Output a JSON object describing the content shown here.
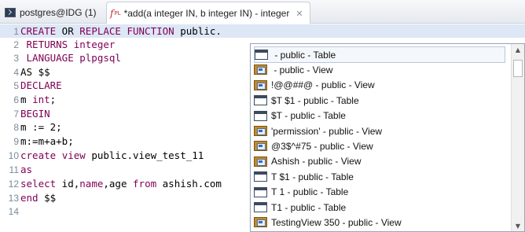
{
  "tabs": [
    {
      "label": "postgres@IDG (1)",
      "icon": "terminal-icon"
    },
    {
      "label": "*add(a integer IN, b integer IN) - integer",
      "icon": "function-icon",
      "icon_text": "f",
      "icon_sub": "PL"
    }
  ],
  "close_glyph": "✕",
  "editor": {
    "lines": [
      {
        "num": "1",
        "parts": [
          {
            "t": "CREATE",
            "k": true
          },
          {
            "t": " OR ",
            "k": false
          },
          {
            "t": "REPLACE",
            "k": true
          },
          {
            "t": " ",
            "k": false
          },
          {
            "t": "FUNCTION",
            "k": true
          },
          {
            "t": " public.",
            "k": false
          }
        ]
      },
      {
        "num": "2",
        "parts": [
          {
            "t": " RETURNS integer",
            "k": true
          }
        ]
      },
      {
        "num": "3",
        "parts": [
          {
            "t": " LANGUAGE plpgsql",
            "k": true
          }
        ]
      },
      {
        "num": "4",
        "parts": [
          {
            "t": "AS $$",
            "k": false
          }
        ]
      },
      {
        "num": "5",
        "parts": [
          {
            "t": "DECLARE",
            "k": true
          }
        ]
      },
      {
        "num": "6",
        "parts": [
          {
            "t": "m ",
            "k": false
          },
          {
            "t": "int",
            "k": true
          },
          {
            "t": ";",
            "k": false
          }
        ]
      },
      {
        "num": "7",
        "parts": [
          {
            "t": "BEGIN",
            "k": true
          }
        ]
      },
      {
        "num": "8",
        "parts": [
          {
            "t": "m := 2;",
            "k": false
          }
        ]
      },
      {
        "num": "9",
        "parts": [
          {
            "t": "m:=m+a+b;",
            "k": false
          }
        ]
      },
      {
        "num": "10",
        "parts": [
          {
            "t": "create",
            "k": true
          },
          {
            "t": " ",
            "k": false
          },
          {
            "t": "view",
            "k": true
          },
          {
            "t": " public.view_test_11",
            "k": false
          }
        ]
      },
      {
        "num": "11",
        "parts": [
          {
            "t": "as",
            "k": true
          }
        ]
      },
      {
        "num": "12",
        "parts": [
          {
            "t": "select",
            "k": true
          },
          {
            "t": " id,",
            "k": false
          },
          {
            "t": "name",
            "k": true
          },
          {
            "t": ",age ",
            "k": false
          },
          {
            "t": "from",
            "k": true
          },
          {
            "t": " ashish.com",
            "k": false
          }
        ]
      },
      {
        "num": "13",
        "parts": [
          {
            "t": "end",
            "k": true
          },
          {
            "t": " $$",
            "k": false
          }
        ]
      },
      {
        "num": "14",
        "parts": []
      }
    ]
  },
  "autocomplete": {
    "items": [
      {
        "label": " - public - Table",
        "type": "table"
      },
      {
        "label": " - public - View",
        "type": "view"
      },
      {
        "label": "!@@##@ - public - View",
        "type": "view"
      },
      {
        "label": "$T $1 - public - Table",
        "type": "table"
      },
      {
        "label": "$T - public - Table",
        "type": "table"
      },
      {
        "label": "'permission' - public - View",
        "type": "view"
      },
      {
        "label": "@3$^#75 - public - View",
        "type": "view"
      },
      {
        "label": "Ashish - public - View",
        "type": "view"
      },
      {
        "label": "T $1 - public - Table",
        "type": "table"
      },
      {
        "label": "T 1 - public - Table",
        "type": "table"
      },
      {
        "label": "T1 - public - Table",
        "type": "table"
      },
      {
        "label": "TestingView 350 - public - View",
        "type": "view"
      }
    ],
    "scroll_up": "▲",
    "scroll_down": "▼"
  }
}
